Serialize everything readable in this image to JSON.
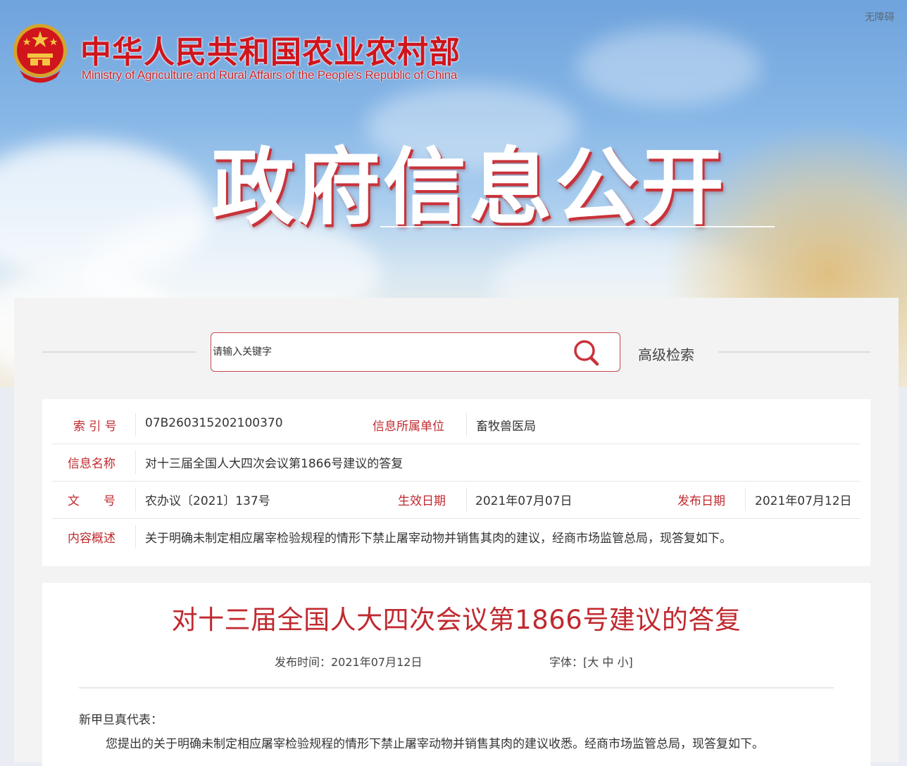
{
  "header": {
    "accessibility_label": "无障碍",
    "org_name_cn": "中华人民共和国农业农村部",
    "org_name_en": "Ministry of Agriculture and Rural Affairs of the People's Republic of China",
    "banner_title": "政府信息公开"
  },
  "search": {
    "placeholder": "请输入关键字",
    "advanced_label": "高级检索",
    "icon": "search-icon"
  },
  "meta": {
    "index_no_label": "索 引 号",
    "index_no_value": "07B260315202100370",
    "unit_label": "信息所属单位",
    "unit_value": "畜牧兽医局",
    "info_name_label": "信息名称",
    "info_name_value": "对十三届全国人大四次会议第1866号建议的答复",
    "doc_no_label": "文　　号",
    "doc_no_value": "农办议〔2021〕137号",
    "effective_label": "生效日期",
    "effective_value": "2021年07月07日",
    "publish_label": "发布日期",
    "publish_value": "2021年07月12日",
    "summary_label": "内容概述",
    "summary_value": "关于明确未制定相应屠宰检验规程的情形下禁止屠宰动物并销售其肉的建议，经商市场监管总局，现答复如下。"
  },
  "article": {
    "title": "对十三届全国人大四次会议第1866号建议的答复",
    "publish_time": "发布时间：2021年07月12日",
    "font_label": "字体：",
    "font_open": "[",
    "font_large": "大",
    "font_medium": "中",
    "font_small": "小",
    "font_close": "]",
    "salutation": "新甲旦真代表：",
    "paragraph_1": "您提出的关于明确未制定相应屠宰检验规程的情形下禁止屠宰动物并销售其肉的建议收悉。经商市场监管总局，现答复如下。"
  },
  "colors": {
    "accent_red": "#c0292f",
    "brand_red": "#d0151c"
  }
}
